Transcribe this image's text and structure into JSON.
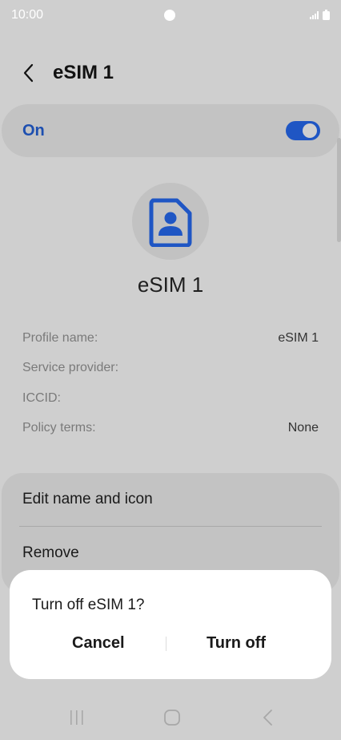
{
  "status_bar": {
    "time": "10:00"
  },
  "header": {
    "title": "eSIM 1"
  },
  "toggle": {
    "label": "On",
    "state": "on",
    "accent": "#1f56c4"
  },
  "profile": {
    "display_name": "eSIM 1"
  },
  "details": [
    {
      "label": "Profile name:",
      "value": "eSIM 1"
    },
    {
      "label": "Service provider:",
      "value": ""
    },
    {
      "label": "ICCID:",
      "value": ""
    },
    {
      "label": "Policy terms:",
      "value": "None"
    }
  ],
  "actions": {
    "edit_label": "Edit name and icon",
    "remove_label": "Remove"
  },
  "dialog": {
    "title": "Turn off eSIM 1?",
    "cancel_label": "Cancel",
    "confirm_label": "Turn off"
  },
  "icons": {
    "back": "chevron-left-icon",
    "sim": "sim-card-person-icon",
    "nav_recents": "recents-icon",
    "nav_home": "home-icon",
    "nav_back": "back-icon"
  }
}
